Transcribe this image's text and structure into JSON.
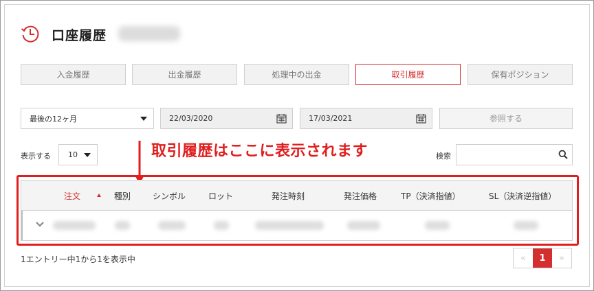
{
  "header": {
    "title": "口座履歴"
  },
  "tabs": [
    {
      "label": "入金履歴",
      "active": false
    },
    {
      "label": "出金履歴",
      "active": false
    },
    {
      "label": "処理中の出金",
      "active": false
    },
    {
      "label": "取引履歴",
      "active": true
    },
    {
      "label": "保有ポジション",
      "active": false
    }
  ],
  "filters": {
    "range_selected": "最後の12ヶ月",
    "date_from": "22/03/2020",
    "date_to": "17/03/2021",
    "reference_button": "参照する"
  },
  "list_controls": {
    "show_label": "表示する",
    "page_size": "10",
    "search_label": "検索",
    "search_value": ""
  },
  "annotation": "取引履歴はここに表示されます",
  "table": {
    "columns": [
      "注文",
      "種別",
      "シンボル",
      "ロット",
      "発注時刻",
      "発注価格",
      "TP（決済指値）",
      "SL（決済逆指値）"
    ],
    "sorted_column": "注文",
    "sort_direction": "ascending"
  },
  "footer": {
    "info": "1エントリー中1から1を表示中",
    "pagination": {
      "prev": "«",
      "current": "1",
      "next": "»"
    }
  },
  "colors": {
    "accent": "#d32f2f",
    "annotation": "#e01e1e"
  },
  "icons": {
    "history": "clock-history-icon",
    "calendar": "calendar-icon",
    "search": "search-icon",
    "expand": "chevron-down-icon"
  }
}
